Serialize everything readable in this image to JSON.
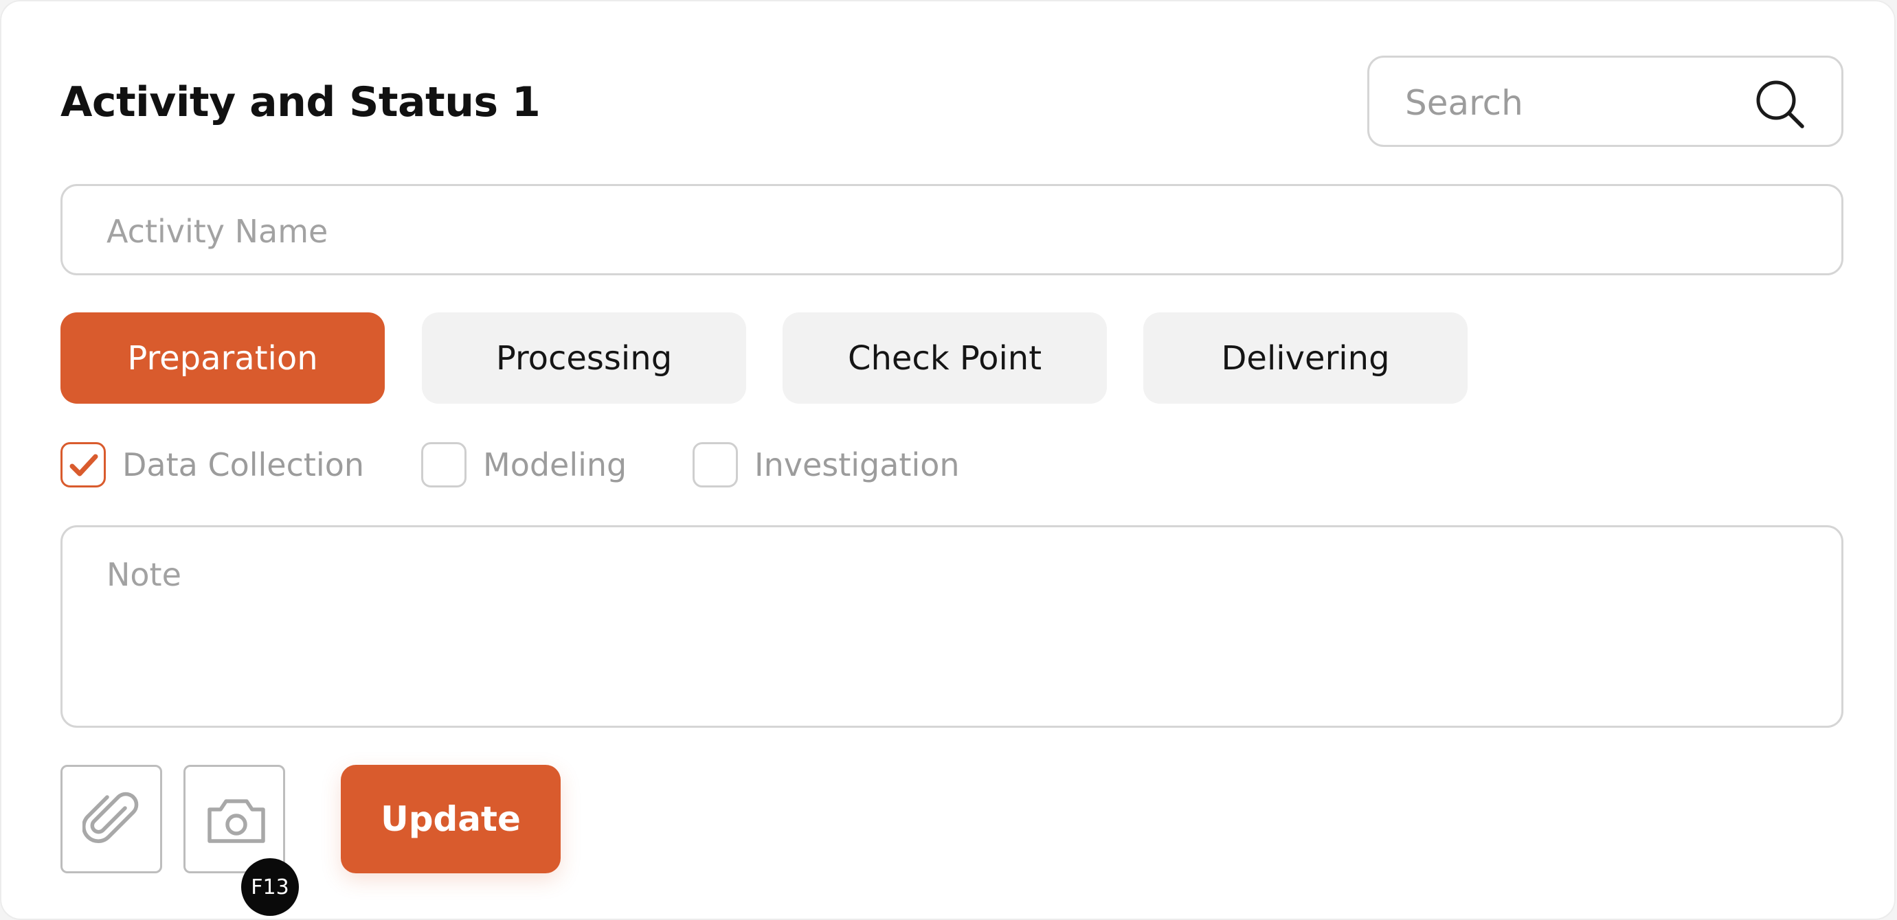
{
  "header": {
    "title": "Activity and Status 1"
  },
  "search": {
    "placeholder": "Search",
    "value": ""
  },
  "activity_name": {
    "placeholder": "Activity Name",
    "value": ""
  },
  "tabs": [
    {
      "label": "Preparation",
      "active": true
    },
    {
      "label": "Processing",
      "active": false
    },
    {
      "label": "Check Point",
      "active": false
    },
    {
      "label": "Delivering",
      "active": false
    }
  ],
  "checkboxes": [
    {
      "label": "Data Collection",
      "checked": true
    },
    {
      "label": "Modeling",
      "checked": false
    },
    {
      "label": "Investigation",
      "checked": false
    }
  ],
  "note": {
    "placeholder": "Note",
    "value": ""
  },
  "actions": {
    "attach_icon": "paperclip-icon",
    "camera_icon": "camera-icon",
    "update_label": "Update"
  },
  "shortcut_badge": "F13",
  "colors": {
    "accent": "#d95b2d",
    "tab_inactive_bg": "#f2f2f2",
    "border": "#d5d5d5",
    "placeholder": "#a2a2a2"
  }
}
